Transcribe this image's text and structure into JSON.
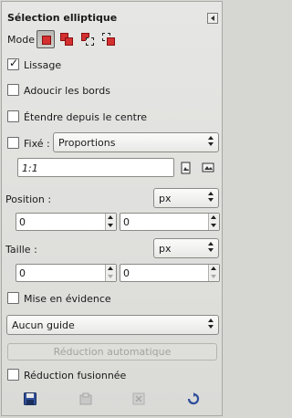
{
  "panel": {
    "title": "Sélection elliptique",
    "menu_icon": "tab-menu-left-arrow-icon"
  },
  "mode": {
    "label": "Mode :",
    "options": [
      {
        "name": "replace",
        "icon": "mode-replace-icon",
        "active": true
      },
      {
        "name": "add",
        "icon": "mode-add-icon",
        "active": false
      },
      {
        "name": "subtract",
        "icon": "mode-subtract-icon",
        "active": false
      },
      {
        "name": "intersect",
        "icon": "mode-intersect-icon",
        "active": false
      }
    ]
  },
  "options": {
    "antialias": {
      "label": "Lissage",
      "checked": true
    },
    "feather": {
      "label": "Adoucir les bords",
      "checked": false
    },
    "expand_center": {
      "label": "Étendre depuis le centre",
      "checked": false
    },
    "fixed": {
      "label": "Fixé :",
      "checked": false,
      "selected": "Proportions"
    },
    "ratio_value": "1:1",
    "highlight": {
      "label": "Mise en évidence",
      "checked": false
    },
    "guides": {
      "selected": "Aucun guide"
    },
    "auto_shrink_label": "Réduction automatique",
    "shrink_merged": {
      "label": "Réduction fusionnée",
      "checked": false
    }
  },
  "position": {
    "label": "Position :",
    "unit": "px",
    "x": "0",
    "y": "0"
  },
  "size": {
    "label": "Taille :",
    "unit": "px",
    "w": "0",
    "h": "0"
  },
  "footer": {
    "icons": [
      "save-icon",
      "restore-icon",
      "delete-icon",
      "reset-icon"
    ]
  },
  "colors": {
    "accent_red": "#d43030",
    "panel_bg": "#e2e2df"
  }
}
